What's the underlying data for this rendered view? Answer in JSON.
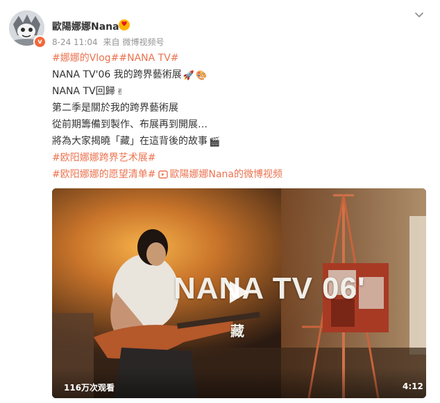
{
  "post": {
    "username": "歐陽娜娜Nana",
    "time": "8-24 11:04",
    "source_prefix": "来自",
    "source": "微博视频号",
    "lines": [
      [
        {
          "type": "topic",
          "text": "#娜娜的Vlog#"
        },
        {
          "type": "topic",
          "text": "#NANA TV#"
        }
      ],
      [
        {
          "type": "text",
          "text": "NANA TV'06 我的跨界藝術展"
        },
        {
          "type": "emoji",
          "icon": "rocket-emoji",
          "glyph": "🚀"
        },
        {
          "type": "emoji",
          "icon": "palette-emoji",
          "glyph": "🎨"
        }
      ],
      [
        {
          "type": "text",
          "text": "NANA TV回歸"
        },
        {
          "type": "emoji",
          "icon": "victory-hand-emoji",
          "glyph": "✌"
        }
      ],
      [
        {
          "type": "text",
          "text": "第二季是關於我的跨界藝術展"
        }
      ],
      [
        {
          "type": "text",
          "text": "從前期籌備到製作、布展再到開展…"
        }
      ],
      [
        {
          "type": "text",
          "text": "將為大家揭曉「藏」在這背後的故事"
        },
        {
          "type": "emoji",
          "icon": "clapper-emoji",
          "glyph": "🎬"
        }
      ],
      [
        {
          "type": "topic",
          "text": "#欧阳娜娜跨界艺术展#"
        }
      ],
      [
        {
          "type": "topic",
          "text": "#欧阳娜娜的愿望清单#"
        },
        {
          "type": "link",
          "text": "歐陽娜娜Nana的微博视频"
        }
      ]
    ]
  },
  "video": {
    "title": "NANA TV 06'",
    "subtitle": "藏",
    "views": "116万次观看",
    "duration": "4:12"
  },
  "colors": {
    "topic": "#eb7350",
    "meta": "#939393",
    "verified_badge": "#f2683a"
  },
  "icons": {
    "menu": "chevron-down-icon",
    "play": "play-icon",
    "link": "video-link-icon"
  }
}
